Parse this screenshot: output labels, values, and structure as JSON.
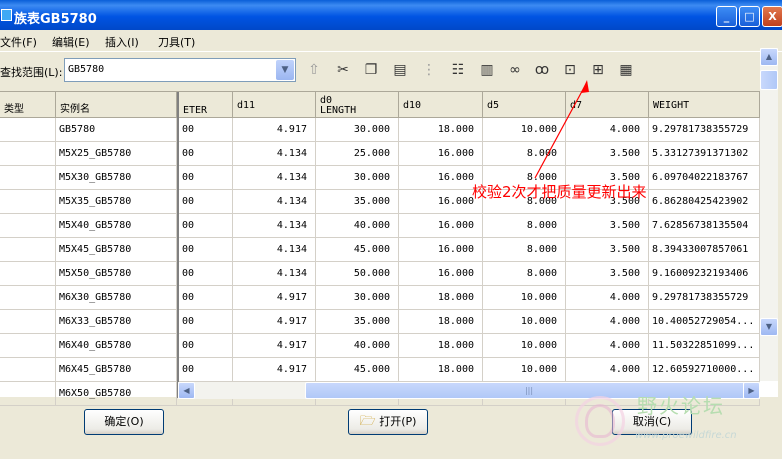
{
  "window": {
    "title": "族表GB5780",
    "buttons": {
      "minimize": "_",
      "maximize": "□",
      "close": "X"
    }
  },
  "menu": [
    "文件(F)",
    "编辑(E)",
    "插入(I)",
    "刀具(T)"
  ],
  "toolbar": {
    "search_label": "查找范围(L):",
    "search_value": "GB5780",
    "icons": [
      "folder-up-icon",
      "cut-icon",
      "copy-icon",
      "paste-icon",
      "rows-icon",
      "tree-icon",
      "columns-icon",
      "binoculars-icon",
      "glasses-icon",
      "lock-icon",
      "table-verify-icon",
      "table-icon"
    ]
  },
  "table": {
    "columns": [
      {
        "l1": "类型",
        "l2": ""
      },
      {
        "l1": "实例名",
        "l2": ""
      },
      {
        "l1": "",
        "l2": "ETER"
      },
      {
        "l1": "d11",
        "l2": ""
      },
      {
        "l1": "d0",
        "l2": "LENGTH"
      },
      {
        "l1": "d10",
        "l2": ""
      },
      {
        "l1": "d5",
        "l2": ""
      },
      {
        "l1": "d7",
        "l2": ""
      },
      {
        "l1": "WEIGHT",
        "l2": ""
      }
    ],
    "rows": [
      [
        "",
        "GB5780",
        "00",
        "4.917",
        "30.000",
        "18.000",
        "10.000",
        "4.000",
        "9.29781738355729"
      ],
      [
        "",
        "M5X25_GB5780",
        "00",
        "4.134",
        "25.000",
        "16.000",
        "8.000",
        "3.500",
        "5.33127391371302"
      ],
      [
        "",
        "M5X30_GB5780",
        "00",
        "4.134",
        "30.000",
        "16.000",
        "8.000",
        "3.500",
        "6.09704022183767"
      ],
      [
        "",
        "M5X35_GB5780",
        "00",
        "4.134",
        "35.000",
        "16.000",
        "8.000",
        "3.500",
        "6.86280425423902"
      ],
      [
        "",
        "M5X40_GB5780",
        "00",
        "4.134",
        "40.000",
        "16.000",
        "8.000",
        "3.500",
        "7.62856738135504"
      ],
      [
        "",
        "M5X45_GB5780",
        "00",
        "4.134",
        "45.000",
        "16.000",
        "8.000",
        "3.500",
        "8.39433007857061"
      ],
      [
        "",
        "M5X50_GB5780",
        "00",
        "4.134",
        "50.000",
        "16.000",
        "8.000",
        "3.500",
        "9.16009232193406"
      ],
      [
        "",
        "M6X30_GB5780",
        "00",
        "4.917",
        "30.000",
        "18.000",
        "10.000",
        "4.000",
        "9.29781738355729"
      ],
      [
        "",
        "M6X33_GB5780",
        "00",
        "4.917",
        "35.000",
        "18.000",
        "10.000",
        "4.000",
        "10.40052729054..."
      ],
      [
        "",
        "M6X40_GB5780",
        "00",
        "4.917",
        "40.000",
        "18.000",
        "10.000",
        "4.000",
        "11.50322851099..."
      ],
      [
        "",
        "M6X45_GB5780",
        "00",
        "4.917",
        "45.000",
        "18.000",
        "10.000",
        "4.000",
        "12.60592710000..."
      ],
      [
        "",
        "M6X50_GB5780",
        "",
        "",
        "",
        "",
        "",
        "",
        ""
      ]
    ]
  },
  "annotation": "校验2次才把质量更新出来",
  "footer": {
    "ok": "确定(O)",
    "open": "打开(P)",
    "cancel": "取消(C)"
  },
  "watermark": {
    "text": "野火论坛",
    "url": "www.proewildfire.cn"
  },
  "colors": {
    "titlebar": "#0054E3",
    "annotation": "#FF0000",
    "face": "#ECE9D8"
  }
}
